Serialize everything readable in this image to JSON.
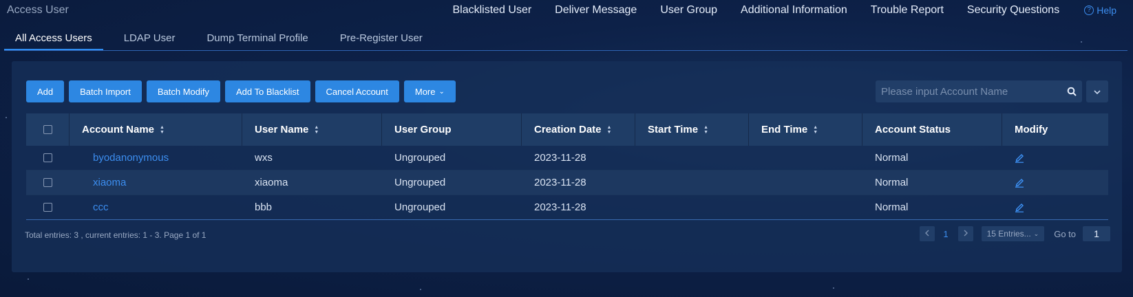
{
  "app_title": "Access User",
  "top_nav": [
    "Blacklisted User",
    "Deliver Message",
    "User Group",
    "Additional Information",
    "Trouble Report",
    "Security Questions"
  ],
  "help": {
    "icon_glyph": "?",
    "label": "Help"
  },
  "tabs": [
    "All Access Users",
    "LDAP User",
    "Dump Terminal Profile",
    "Pre-Register User"
  ],
  "active_tab": "All Access Users",
  "toolbar": {
    "buttons": [
      "Add",
      "Batch Import",
      "Batch Modify",
      "Add To Blacklist",
      "Cancel Account"
    ],
    "more_label": "More"
  },
  "search": {
    "placeholder": "Please input Account Name"
  },
  "table": {
    "columns": [
      "Account Name",
      "User Name",
      "User Group",
      "Creation Date",
      "Start Time",
      "End Time",
      "Account Status",
      "Modify"
    ],
    "rows": [
      {
        "account_name": "byodanonymous",
        "user_name": "wxs",
        "user_group": "Ungrouped",
        "creation_date": "2023-11-28",
        "start_time": "",
        "end_time": "",
        "account_status": "Normal"
      },
      {
        "account_name": "xiaoma",
        "user_name": "xiaoma",
        "user_group": "Ungrouped",
        "creation_date": "2023-11-28",
        "start_time": "",
        "end_time": "",
        "account_status": "Normal"
      },
      {
        "account_name": "ccc",
        "user_name": "bbb",
        "user_group": "Ungrouped",
        "creation_date": "2023-11-28",
        "start_time": "",
        "end_time": "",
        "account_status": "Normal"
      }
    ]
  },
  "footer": {
    "summary": "Total entries: 3 , current entries: 1 - 3. Page 1 of 1",
    "current_page": "1",
    "page_size": "15 Entries...",
    "goto_label": "Go to",
    "goto_value": "1"
  },
  "colors": {
    "accent": "#2d87e2",
    "link": "#3c8ef0",
    "background": "#0d2148"
  },
  "icons": {
    "search": "search-icon",
    "edit": "edit-icon",
    "help": "help-icon",
    "expand": "chevron-down-icon"
  }
}
